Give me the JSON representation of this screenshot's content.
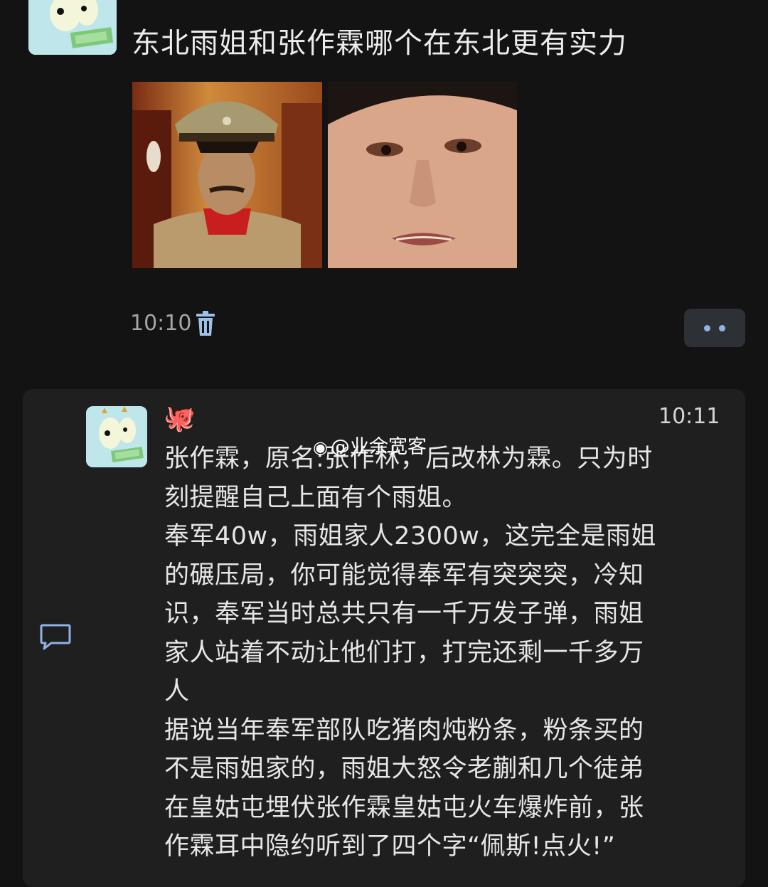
{
  "post": {
    "title": "东北雨姐和张作霖哪个在东北更有实力",
    "time": "10:10"
  },
  "reply": {
    "emoji": "🐙",
    "time": "10:11",
    "watermark": "@业余宽客",
    "lines": [
      "张作霖，原名:张作林，后改林为霖。只为时",
      "刻提醒自己上面有个雨姐。",
      "奉军40w，雨姐家人2300w，这完全是雨姐",
      "的碾压局，你可能觉得奉军有突突突，冷知",
      "识，奉军当时总共只有一千万发子弹，雨姐",
      "家人站着不动让他们打，打完还剩一千多万",
      "人",
      "据说当年奉军部队吃猪肉炖粉条，粉条买的",
      "不是雨姐家的，雨姐大怒令老蒯和几个徒弟",
      "在皇姑屯埋伏张作霖皇姑屯火车爆炸前，张",
      "作霖耳中隐约听到了四个字“佩斯!点火!”"
    ]
  },
  "icons": {
    "avatar": "cartoon-avatar-icon",
    "delete": "trash-icon",
    "more": "more-dots-icon",
    "comment": "comment-icon",
    "weibo": "weibo-icon"
  },
  "colors": {
    "background": "#131313",
    "card": "#1f1f1f",
    "accent_dots": "#8fb3e6"
  }
}
